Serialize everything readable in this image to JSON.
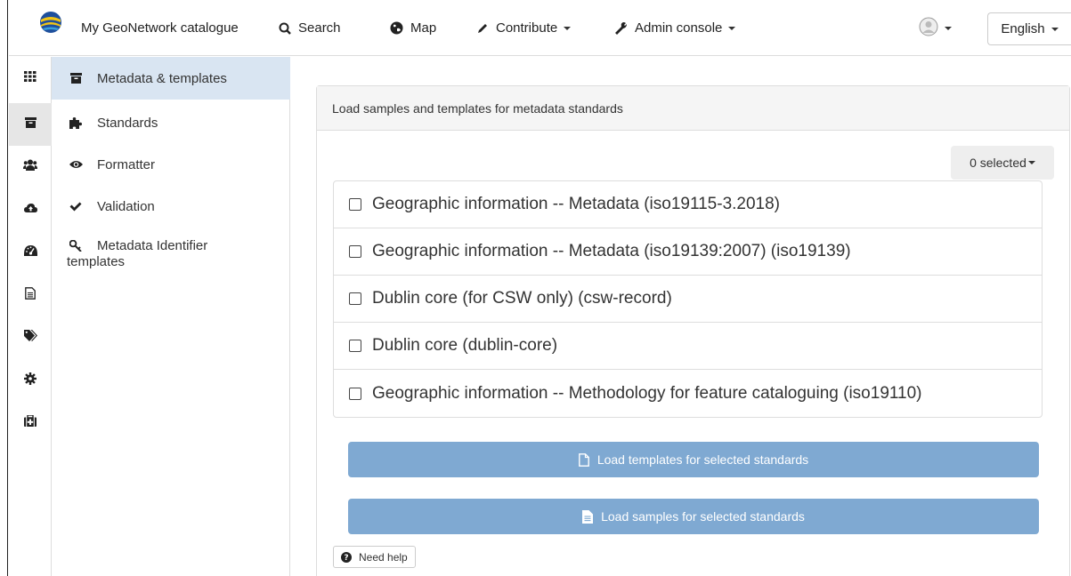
{
  "navbar": {
    "brand": "My GeoNetwork catalogue",
    "items": [
      {
        "label": "Search",
        "icon": "search-icon"
      },
      {
        "label": "Map",
        "icon": "globe-icon"
      },
      {
        "label": "Contribute",
        "icon": "pencil-icon"
      },
      {
        "label": "Admin console",
        "icon": "wrench-icon"
      }
    ],
    "language": "English"
  },
  "rail": {
    "icons": [
      "grid-icon",
      "archive-icon",
      "users-icon",
      "cloud-upload-icon",
      "dashboard-icon",
      "file-icon",
      "tags-icon",
      "cog-icon",
      "medkit-icon"
    ],
    "active_index": 1
  },
  "subnav": {
    "items": [
      {
        "label": "Metadata & templates",
        "icon": "archive-icon",
        "active": true
      },
      {
        "label": "Standards",
        "icon": "puzzle-icon"
      },
      {
        "label": "Formatter",
        "icon": "eye-icon"
      },
      {
        "label": "Validation",
        "icon": "check-icon"
      },
      {
        "label": "Metadata Identifier templates",
        "icon": "key-icon"
      }
    ]
  },
  "panel": {
    "heading": "Load samples and templates for metadata standards",
    "selected_label": "0 selected",
    "standards": [
      "Geographic information -- Metadata (iso19115-3.2018)",
      "Geographic information -- Metadata (iso19139:2007) (iso19139)",
      "Dublin core (for CSW only) (csw-record)",
      "Dublin core (dublin-core)",
      "Geographic information -- Methodology for feature cataloguing (iso19110)"
    ],
    "load_templates_label": "Load templates for selected standards",
    "load_samples_label": "Load samples for selected standards",
    "help_label": "Need help"
  },
  "colors": {
    "primary_button": "#7fa9d2",
    "active_subnav": "#d9e5f2",
    "active_rail": "#e6e6e6"
  }
}
